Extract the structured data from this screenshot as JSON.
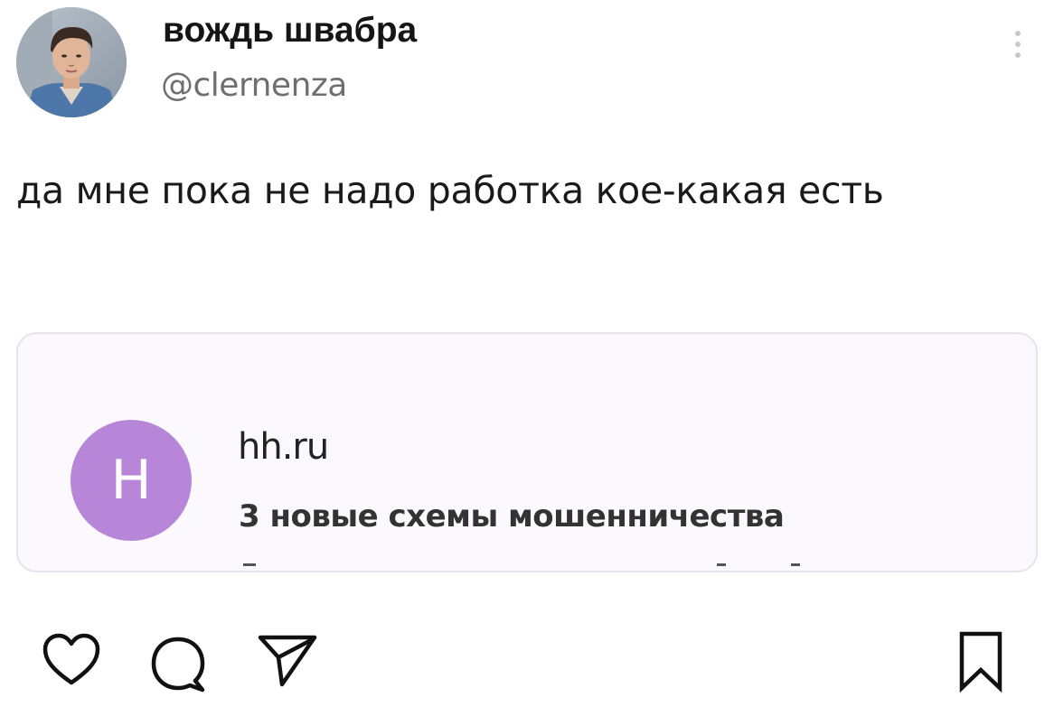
{
  "post": {
    "author": {
      "display_name": "вождь швабра",
      "handle": "@clernenza",
      "avatar_icon": "profile-photo"
    },
    "text": "да мне пока не надо работка кое-какая есть",
    "more_icon": "vertical-dots-icon"
  },
  "link_card": {
    "logo_letter": "H",
    "logo_color": "#b886d9",
    "site": "hh.ru",
    "title": "3 новые схемы мошенничества"
  },
  "actions": {
    "like_icon": "heart-icon",
    "comment_icon": "comment-bubble-icon",
    "share_icon": "send-paper-plane-icon",
    "save_icon": "bookmark-icon"
  }
}
